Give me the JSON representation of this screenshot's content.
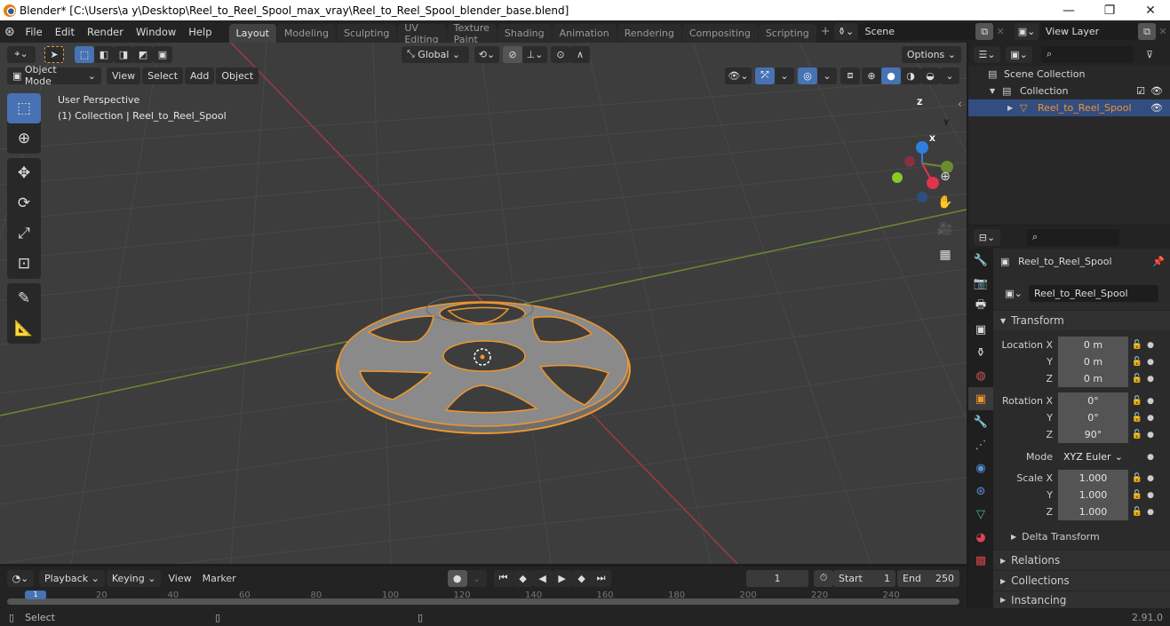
{
  "window": {
    "title": "Blender* [C:\\Users\\a y\\Desktop\\Reel_to_Reel_Spool_max_vray\\Reel_to_Reel_Spool_blender_base.blend]",
    "minimize": "—",
    "maximize": "❐",
    "close": "✕"
  },
  "menu": [
    "File",
    "Edit",
    "Render",
    "Window",
    "Help"
  ],
  "workspaces": [
    {
      "label": "Layout",
      "active": true
    },
    {
      "label": "Modeling"
    },
    {
      "label": "Sculpting"
    },
    {
      "label": "UV Editing"
    },
    {
      "label": "Texture Paint"
    },
    {
      "label": "Shading"
    },
    {
      "label": "Animation"
    },
    {
      "label": "Rendering"
    },
    {
      "label": "Compositing"
    },
    {
      "label": "Scripting"
    }
  ],
  "add_workspace": "+",
  "scene": {
    "label": "Scene"
  },
  "view_layer": {
    "label": "View Layer"
  },
  "viewport": {
    "transform_orientation": "Global",
    "options": "Options",
    "mode": "Object Mode",
    "menus": [
      "View",
      "Select",
      "Add",
      "Object"
    ],
    "overlay_text_1": "User Perspective",
    "overlay_text_2": "(1) Collection | Reel_to_Reel_Spool",
    "gizmo": {
      "x": "X",
      "y": "Y",
      "z": "Z"
    },
    "colors": {
      "x_axis": "#9e3a44",
      "y_axis": "#6c8b2e",
      "grid": "#4a4a4a",
      "selection": "#f0962d",
      "background": "#3d3d3d"
    }
  },
  "outliner": {
    "scene_collection": "Scene Collection",
    "collection": "Collection",
    "object": "Reel_to_Reel_Spool",
    "search_placeholder": ""
  },
  "properties": {
    "object_name": "Reel_to_Reel_Spool",
    "data_name": "Reel_to_Reel_Spool",
    "transform_label": "Transform",
    "location": {
      "label": "Location X",
      "x": "0 m",
      "y": "0 m",
      "z": "0 m"
    },
    "rotation": {
      "label": "Rotation X",
      "x": "0°",
      "y": "0°",
      "z": "90°"
    },
    "mode": {
      "label": "Mode",
      "value": "XYZ Euler"
    },
    "scale": {
      "label": "Scale X",
      "x": "1.000",
      "y": "1.000",
      "z": "1.000"
    },
    "axis_y": "Y",
    "axis_z": "Z",
    "delta_transform": "Delta Transform",
    "sections": [
      "Relations",
      "Collections",
      "Instancing"
    ]
  },
  "timeline": {
    "menus": [
      "Playback",
      "Keying",
      "View",
      "Marker"
    ],
    "current_frame": "1",
    "start_label": "Start",
    "start": "1",
    "end_label": "End",
    "end": "250",
    "ruler": [
      "1",
      "20",
      "40",
      "60",
      "80",
      "100",
      "120",
      "140",
      "160",
      "180",
      "200",
      "220",
      "240"
    ]
  },
  "status": {
    "select": "Select",
    "version": "2.91.0"
  },
  "accent": "#4772b3"
}
